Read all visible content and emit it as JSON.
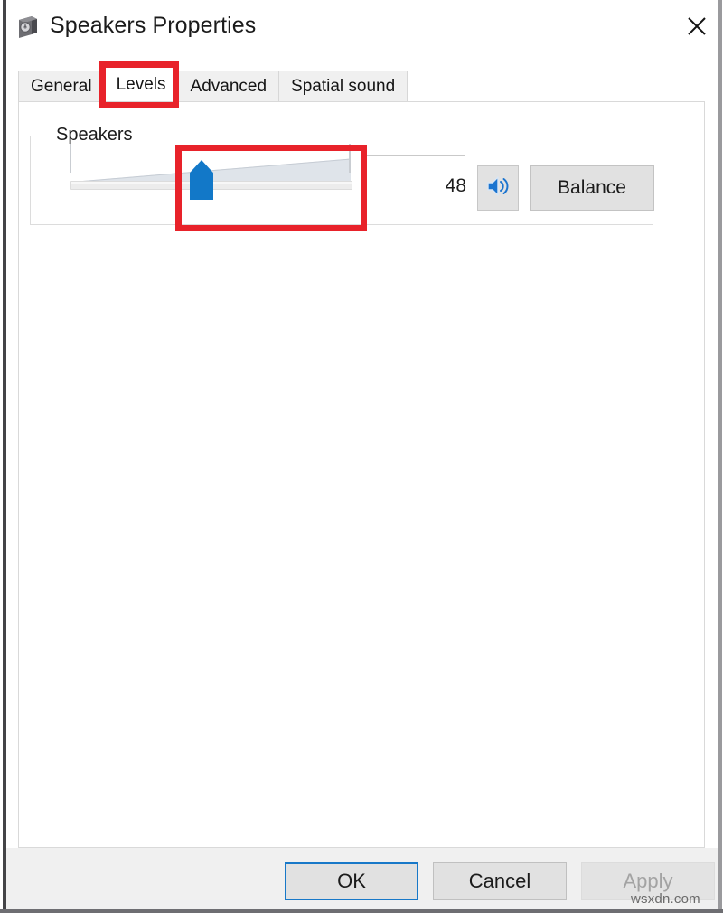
{
  "window": {
    "title": "Speakers Properties",
    "icon": "speaker-device-icon",
    "close_label": "✕"
  },
  "tabs": [
    {
      "label": "General",
      "active": false
    },
    {
      "label": "Levels",
      "active": true
    },
    {
      "label": "Advanced",
      "active": false
    },
    {
      "label": "Spatial sound",
      "active": false
    }
  ],
  "levels": {
    "group_label": "Speakers",
    "volume_value": "48",
    "volume_min": 0,
    "volume_max": 100,
    "mute_icon": "speaker-volume-icon",
    "balance_label": "Balance"
  },
  "footer": {
    "ok_label": "OK",
    "cancel_label": "Cancel",
    "apply_label": "Apply"
  },
  "watermark": "wsxdn.com",
  "colors": {
    "accent": "#1278c8",
    "annotation": "#e8222a",
    "focus_border": "#1878c8",
    "disabled_text": "#a3a3a3"
  }
}
